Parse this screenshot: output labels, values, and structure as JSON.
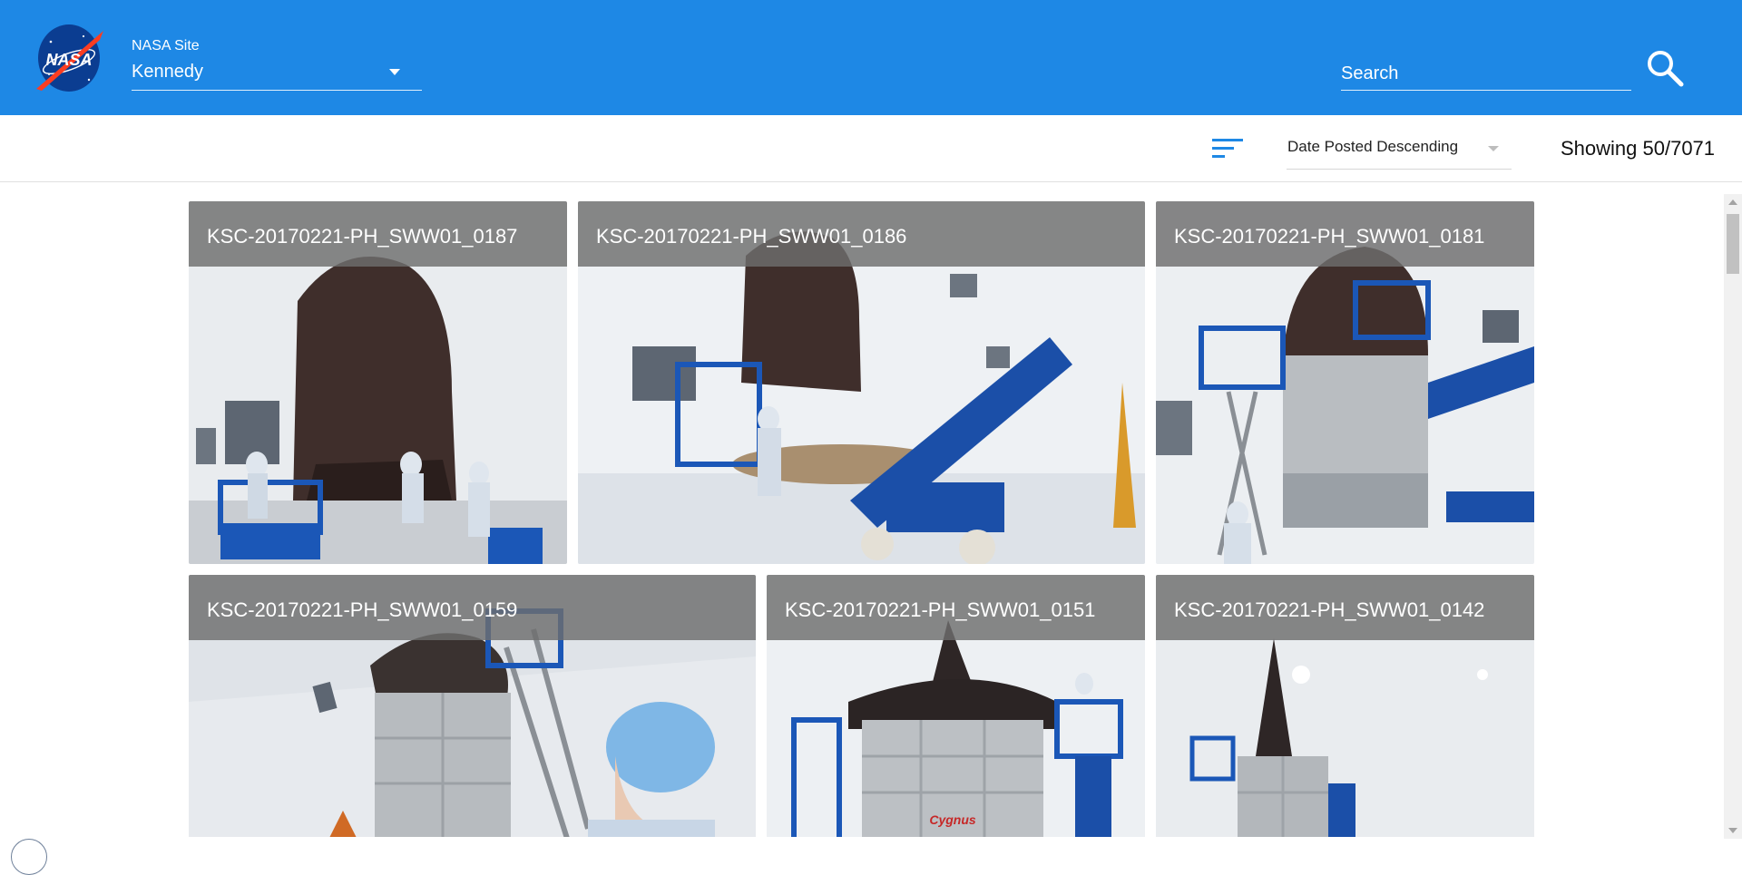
{
  "header": {
    "logo_text": "NASA",
    "site_label": "NASA Site",
    "site_value": "Kennedy",
    "search_placeholder": "Search"
  },
  "toolbar": {
    "sort_value": "Date Posted Descending",
    "count_text": "Showing 50/7071"
  },
  "gallery": {
    "tiles": [
      {
        "title": "KSC-20170221-PH_SWW01_0187"
      },
      {
        "title": "KSC-20170221-PH_SWW01_0186"
      },
      {
        "title": "KSC-20170221-PH_SWW01_0181"
      },
      {
        "title": "KSC-20170221-PH_SWW01_0159"
      },
      {
        "title": "KSC-20170221-PH_SWW01_0151"
      },
      {
        "title": "KSC-20170221-PH_SWW01_0142"
      }
    ]
  },
  "icons": {
    "logo": "nasa-logo-icon",
    "site_dropdown": "caret-down-icon",
    "search": "search-icon",
    "sort": "sort-icon",
    "sort_dropdown": "caret-down-icon"
  },
  "colors": {
    "header_bg": "#1e88e5",
    "accent": "#1e88e5",
    "caption_overlay": "#6e6e6e"
  }
}
